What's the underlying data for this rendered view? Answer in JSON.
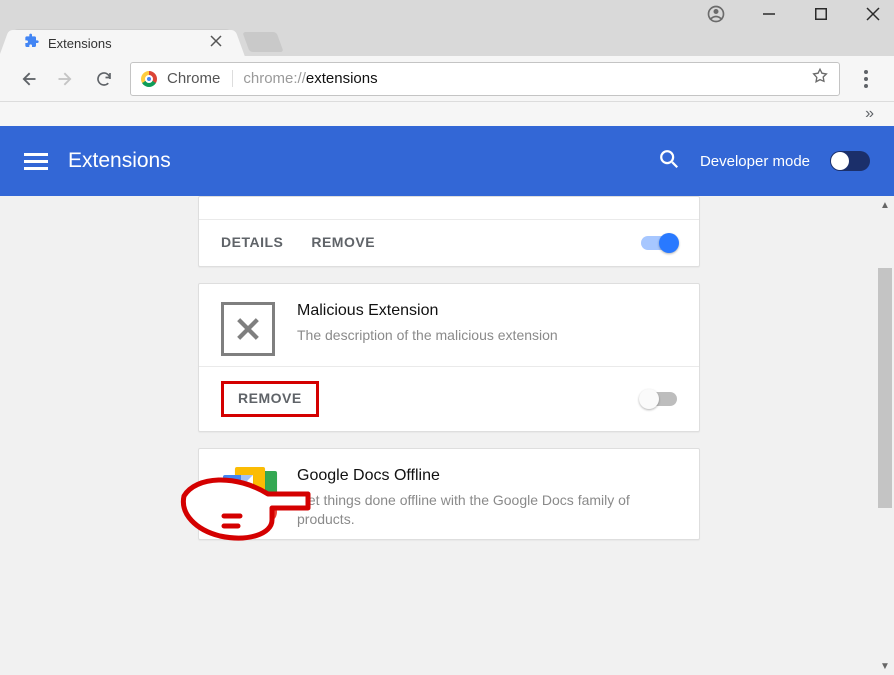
{
  "window": {
    "tab_title": "Extensions"
  },
  "omnibox": {
    "scheme_label": "Chrome",
    "url_prefix": "chrome://",
    "url_bold": "extensions"
  },
  "header": {
    "title": "Extensions",
    "developer_mode_label": "Developer mode"
  },
  "cards": {
    "first": {
      "details": "DETAILS",
      "remove": "REMOVE"
    },
    "malicious": {
      "name": "Malicious Extension",
      "desc": "The description of the malicious extension",
      "remove": "REMOVE"
    },
    "gdocs": {
      "name": "Google Docs Offline",
      "desc": "Get things done offline with the Google Docs family of products."
    }
  }
}
